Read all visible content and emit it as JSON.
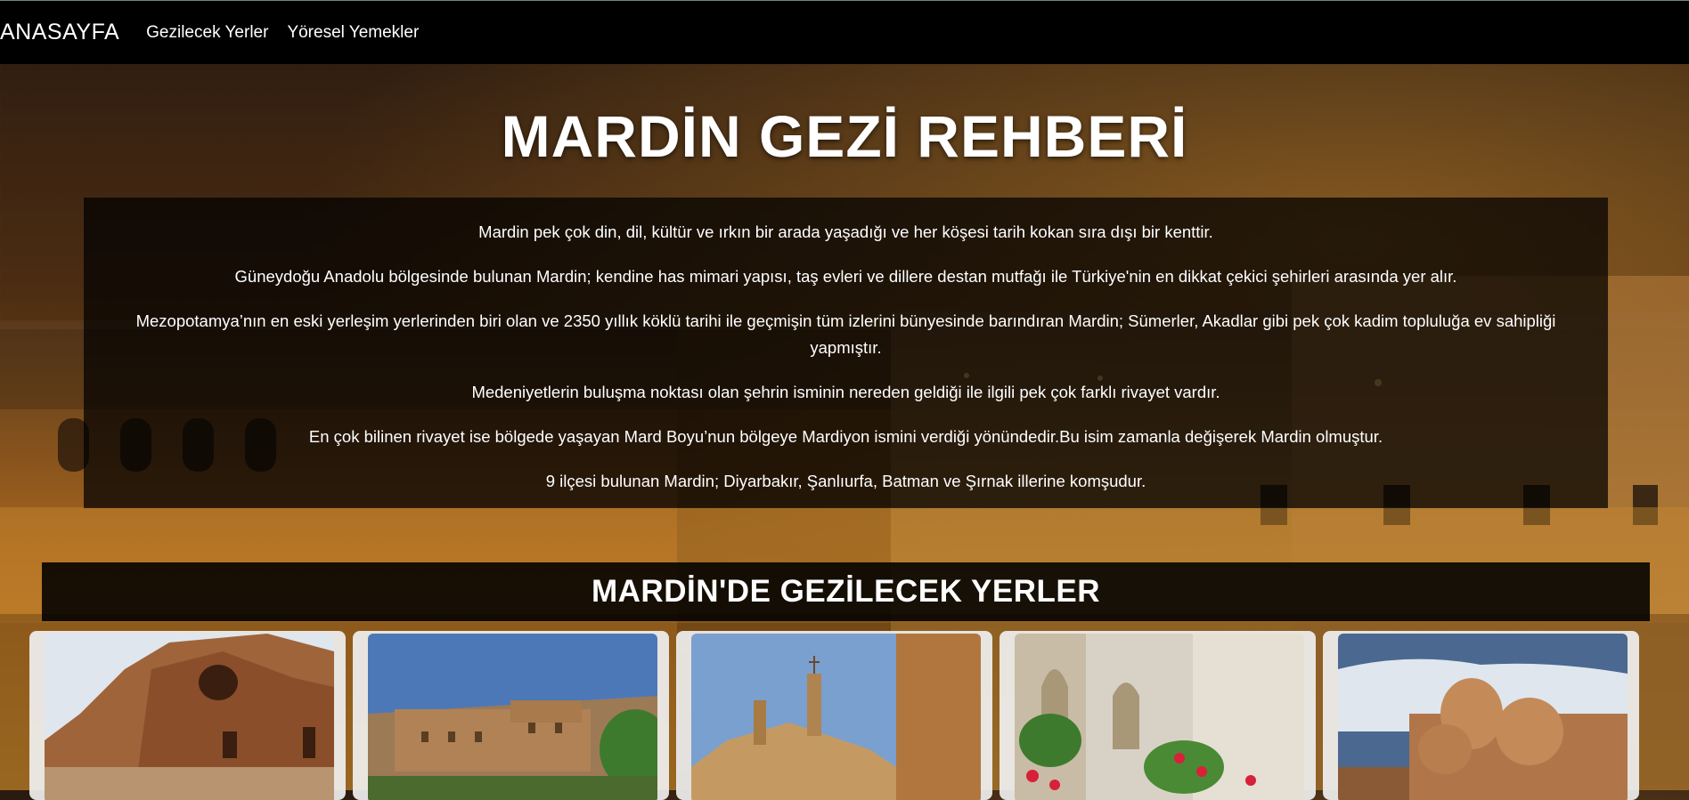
{
  "nav": {
    "brand": "ANASAYFA",
    "links": [
      "Gezilecek Yerler",
      "Yöresel Yemekler"
    ]
  },
  "hero": {
    "title": "MARDİN GEZİ REHBERİ"
  },
  "intro": {
    "paragraphs": [
      "Mardin pek çok din, dil, kültür ve ırkın bir arada yaşadığı ve her köşesi tarih kokan sıra dışı bir kenttir.",
      "Güneydoğu Anadolu bölgesinde bulunan Mardin; kendine has mimari yapısı, taş evleri ve dillere destan mutfağı ile Türkiye'nin en dikkat çekici şehirleri arasında yer alır.",
      "Mezopotamya’nın en eski yerleşim yerlerinden biri olan ve 2350 yıllık köklü tarihi ile geçmişin tüm izlerini bünyesinde barındıran Mardin; Sümerler, Akadlar gibi pek çok kadim topluluğa ev sahipliği yapmıştır.",
      "Medeniyetlerin buluşma noktası olan şehrin isminin nereden geldiği ile ilgili pek çok farklı rivayet vardır.",
      "En çok bilinen rivayet ise bölgede yaşayan Mard Boyu’nun bölgeye Mardiyon ismini verdiği yönündedir.Bu isim zamanla değişerek Mardin olmuştur.",
      "9 ilçesi bulunan Mardin; Diyarbakır, Şanlıurfa, Batman ve Şırnak illerine komşudur."
    ]
  },
  "places_section": {
    "title": "MARDİN'DE GEZİLECEK YERLER"
  },
  "cards": [
    {
      "image": "rock-cave-dwellings-photo",
      "sky": "#dfe6ee",
      "ground": "#a0643a"
    },
    {
      "image": "stone-monastery-photo",
      "sky": "#4d78b8",
      "ground": "#b08256"
    },
    {
      "image": "church-bell-tower-photo",
      "sky": "#7aa0d0",
      "ground": "#c49a62"
    },
    {
      "image": "courtyard-garden-photo",
      "sky": "#d8d2c6",
      "ground": "#5a8a3a"
    },
    {
      "image": "domed-mosque-photo",
      "sky": "#4a6890",
      "ground": "#b0764a"
    }
  ],
  "colors": {
    "navbar": "#000000",
    "overlay": "rgba(0,0,0,0.72)"
  }
}
